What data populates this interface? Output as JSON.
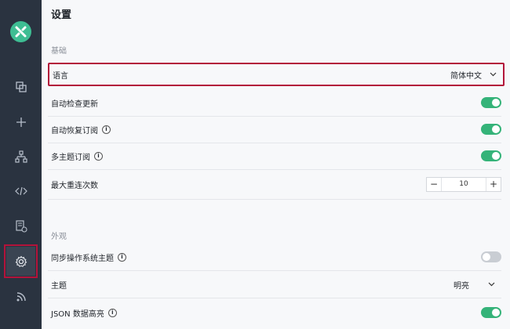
{
  "header": {
    "title": "设置"
  },
  "sections": {
    "basic": "基础",
    "appearance": "外观"
  },
  "settings": {
    "language": {
      "label": "语言",
      "value": "简体中文"
    },
    "auto_check_update": {
      "label": "自动检查更新",
      "enabled": true
    },
    "auto_restore_sub": {
      "label": "自动恢复订阅",
      "enabled": true
    },
    "multi_topic_sub": {
      "label": "多主题订阅",
      "enabled": true
    },
    "max_reconnect": {
      "label": "最大重连次数",
      "value": "10",
      "minus": "−",
      "plus": "+"
    },
    "sync_os_theme": {
      "label": "同步操作系统主题",
      "enabled": false
    },
    "theme": {
      "label": "主题",
      "value": "明亮"
    },
    "json_highlight": {
      "label": "JSON 数据高亮",
      "enabled": true
    }
  },
  "info_glyph": "i",
  "sidebar": {
    "items": [
      "connections-icon",
      "add-icon",
      "topology-icon",
      "code-icon",
      "log-icon",
      "settings-icon",
      "feed-icon"
    ]
  },
  "colors": {
    "accent": "#35b379",
    "highlight": "#b3133a",
    "sidebar": "#2a3340"
  }
}
